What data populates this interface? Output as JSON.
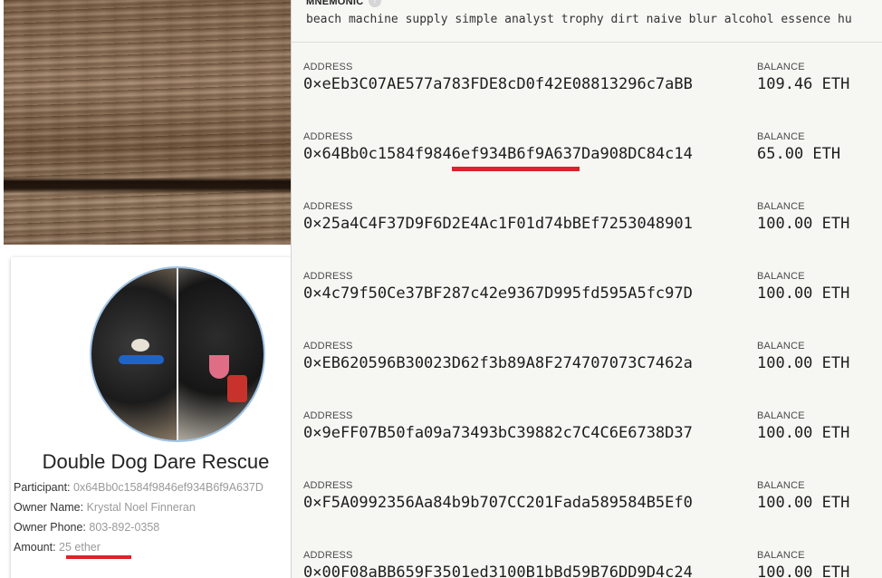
{
  "left_page": {
    "rescue_name": "Double Dog Dare Rescue",
    "fields": [
      {
        "label": "Participant:",
        "value": "0x64Bb0c1584f9846ef934B6f9A637D"
      },
      {
        "label": "Owner Name:",
        "value": "Krystal Noel Finneran"
      },
      {
        "label": "Owner Phone:",
        "value": "803-892-0358"
      },
      {
        "label": "Amount:",
        "value": "25 ether"
      }
    ],
    "accent_underline_color": "#e0202a"
  },
  "ganache": {
    "mnemonic_label": "MNEMONIC",
    "help_glyph": "?",
    "mnemonic": "beach machine supply simple analyst trophy dirt naive blur alcohol essence hu",
    "address_label": "ADDRESS",
    "balance_label": "BALANCE",
    "accounts": [
      {
        "address": "0×eEb3C07AE577a783FDE8cD0f42E08813296c7aBB",
        "balance": "109.46 ETH"
      },
      {
        "address": "0×64Bb0c1584f9846ef934B6f9A637Da908DC84c14",
        "balance": "65.00 ETH"
      },
      {
        "address": "0×25a4C4F37D9F6D2E4Ac1F01d74bBEf7253048901",
        "balance": "100.00 ETH"
      },
      {
        "address": "0×4c79f50Ce37BF287c42e9367D995fd595A5fc97D",
        "balance": "100.00 ETH"
      },
      {
        "address": "0×EB620596B30023D62f3b89A8F274707073C7462a",
        "balance": "100.00 ETH"
      },
      {
        "address": "0×9eFF07B50fa09a73493bC39882c7C4C6E6738D37",
        "balance": "100.00 ETH"
      },
      {
        "address": "0×F5A0992356Aa84b9b707CC201Fada589584B5Ef0",
        "balance": "100.00 ETH"
      },
      {
        "address": "0×00F08aBB659F3501ed3100B1bBd59B76DD9D4c24",
        "balance": "100.00 ETH"
      }
    ],
    "highlight_color": "#f7dc32"
  }
}
